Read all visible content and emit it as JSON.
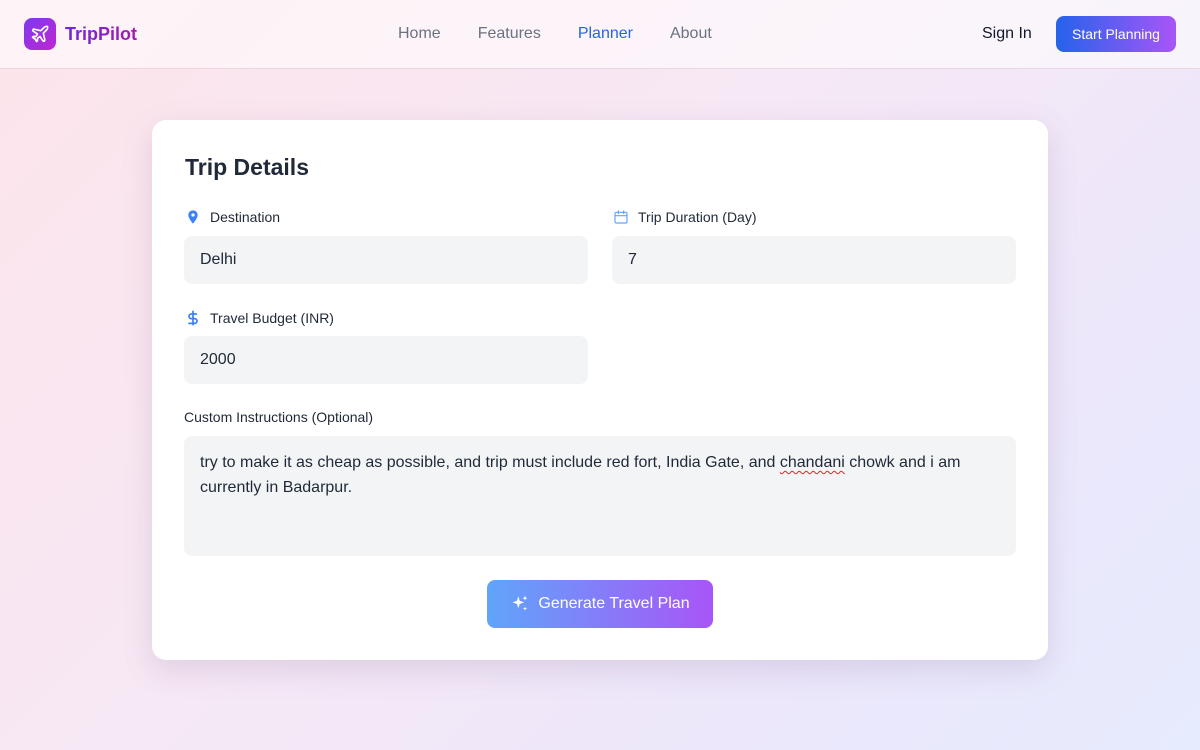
{
  "brand": {
    "name": "TripPilot"
  },
  "nav": [
    {
      "label": "Home",
      "active": false
    },
    {
      "label": "Features",
      "active": false
    },
    {
      "label": "Planner",
      "active": true
    },
    {
      "label": "About",
      "active": false
    }
  ],
  "header": {
    "signin_label": "Sign In",
    "cta_label": "Start Planning"
  },
  "form": {
    "title": "Trip Details",
    "destination": {
      "label": "Destination",
      "value": "Delhi",
      "icon": "map-pin-icon"
    },
    "duration": {
      "label": "Trip Duration (Day)",
      "value": "7",
      "icon": "calendar-icon"
    },
    "budget": {
      "label": "Travel Budget (INR)",
      "value": "2000",
      "icon": "dollar-icon"
    },
    "instructions": {
      "label": "Custom Instructions (Optional)",
      "value_before": "try to make it as cheap as possible, and trip must include red fort, India Gate, and ",
      "value_misspelled": "chandani",
      "value_after": " chowk and i am currently in Badarpur."
    },
    "submit_label": "Generate Travel Plan",
    "submit_icon": "sparkles-icon"
  },
  "colors": {
    "accent": "#2563eb",
    "brand_purple": "#7c3aed",
    "field_bg": "#f3f4f6"
  }
}
